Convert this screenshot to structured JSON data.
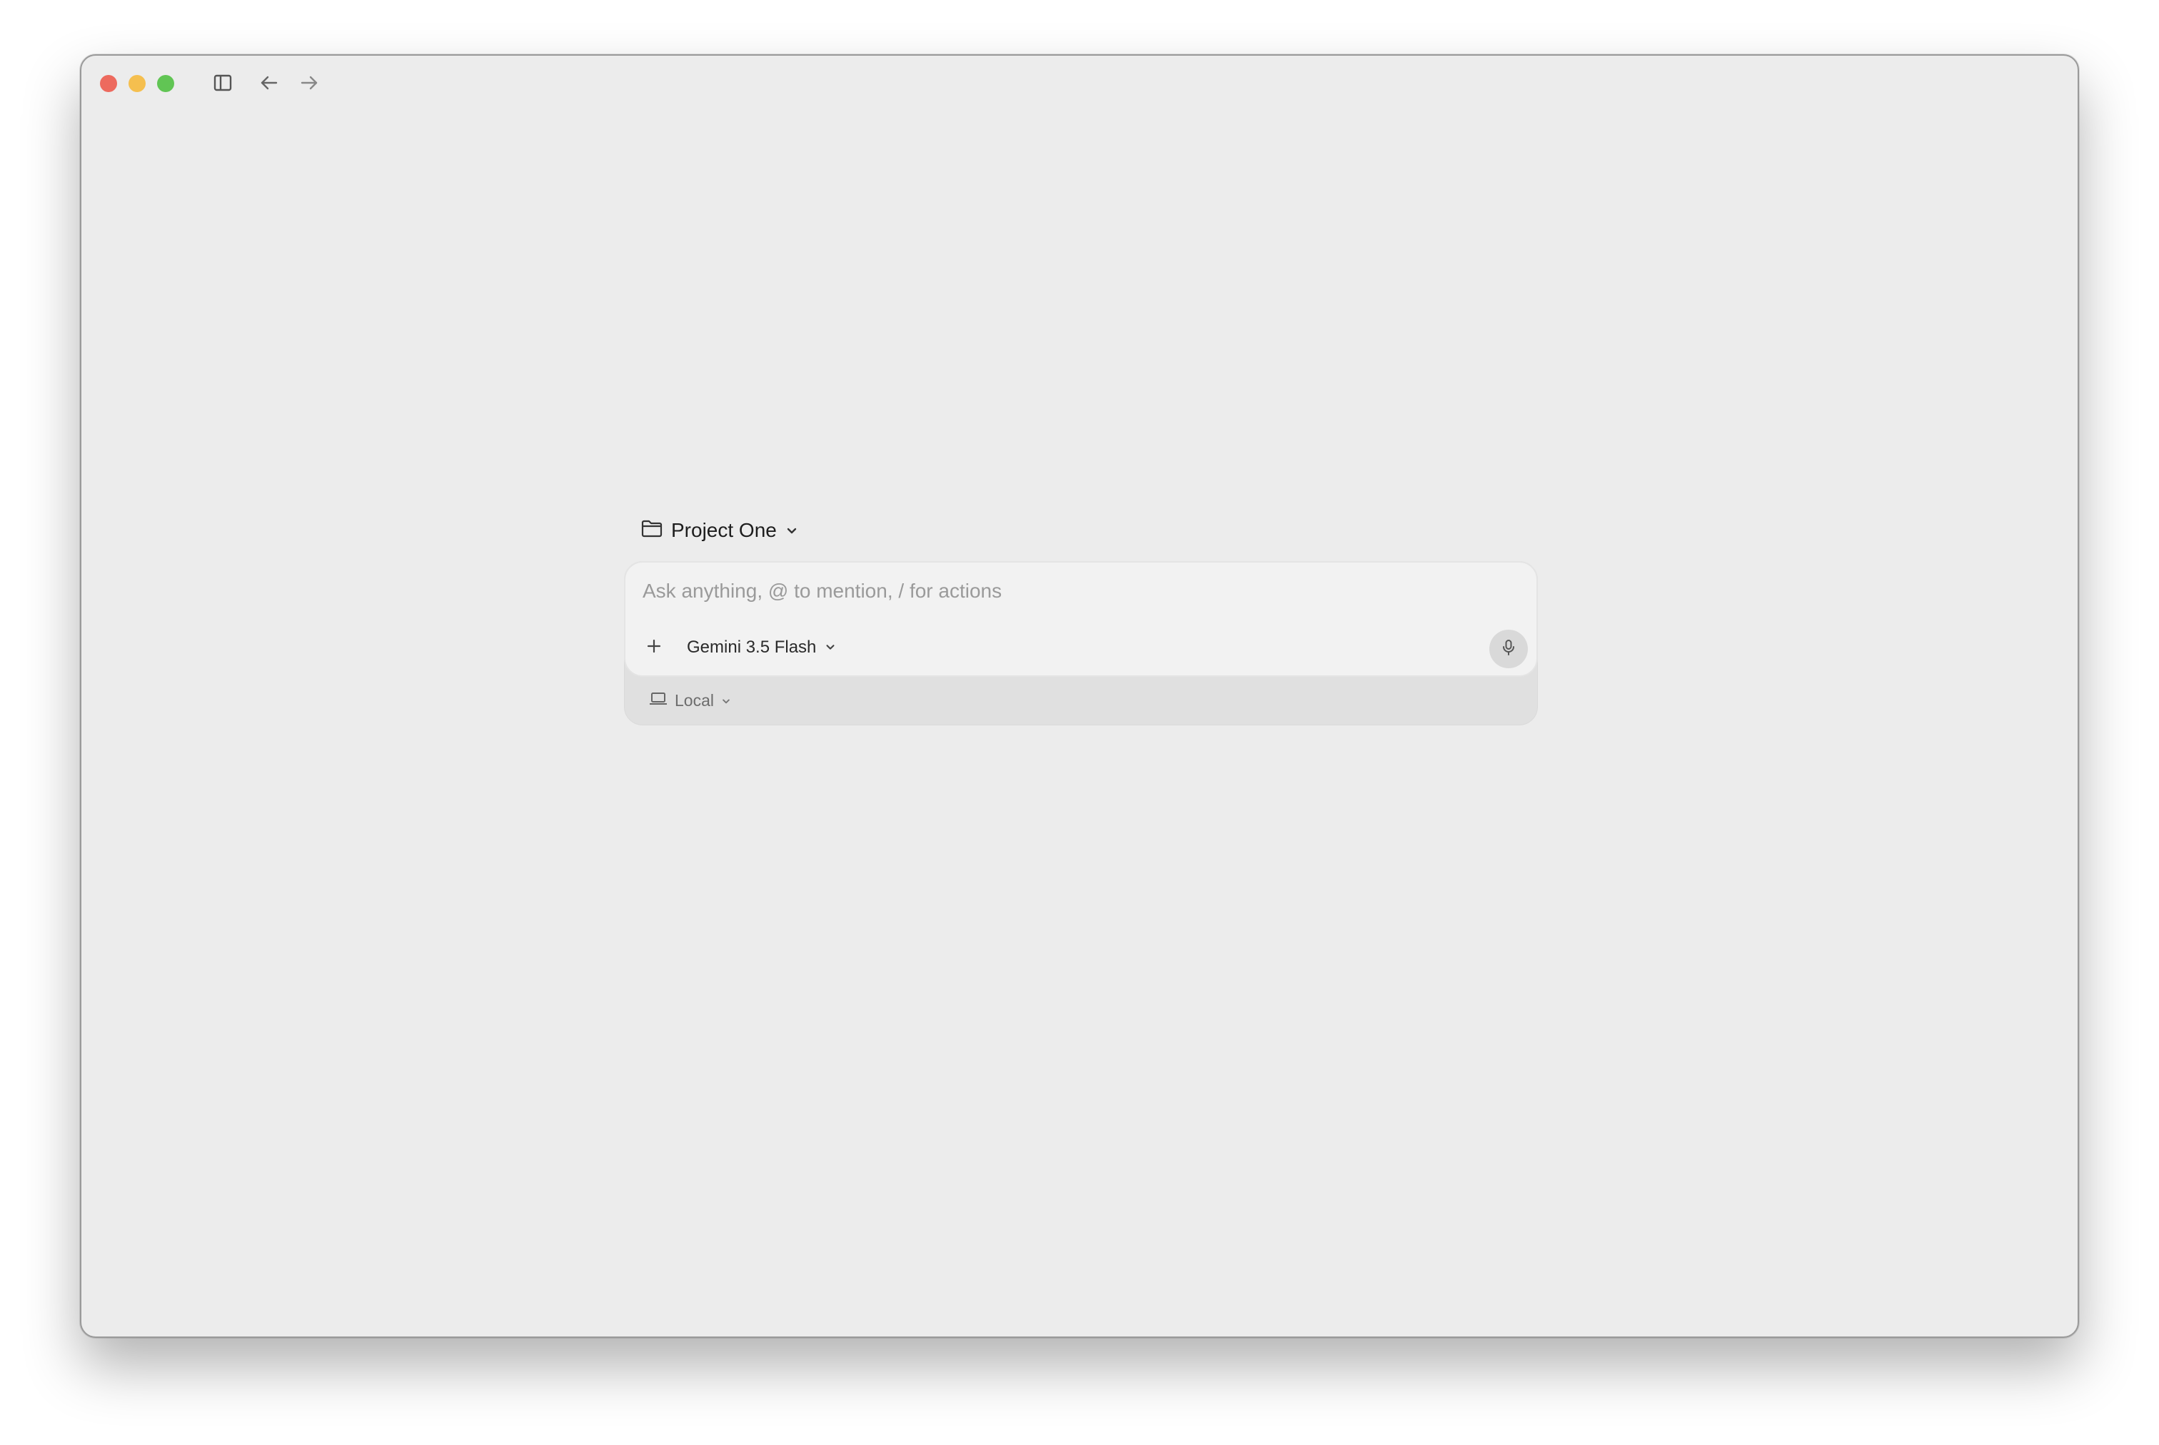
{
  "window": {
    "controls": [
      "close",
      "minimize",
      "maximize"
    ],
    "toolbar_icons": [
      "sidebar-toggle-icon",
      "back-arrow-icon",
      "forward-arrow-icon"
    ]
  },
  "project": {
    "icon": "folder-icon",
    "name": "Project One",
    "dropdown_icon": "chevron-down-icon"
  },
  "composer": {
    "placeholder": "Ask anything, @ to mention, / for actions",
    "value": "",
    "add_icon": "plus-icon",
    "model": "Gemini 3.5 Flash",
    "mic_icon": "microphone-icon",
    "environment": {
      "icon": "laptop-icon",
      "label": "Local"
    }
  },
  "colors": {
    "window_bg": "#ececec",
    "composer_bg": "#f2f2f2",
    "composer_footer_bg": "#e0e0e0",
    "close": "#ed6a5e",
    "minimize": "#f5bf4f",
    "maximize": "#61c554"
  }
}
